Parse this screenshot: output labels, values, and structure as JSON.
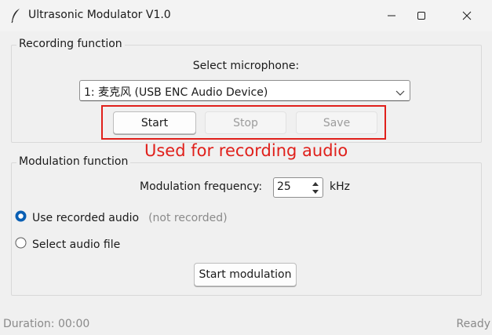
{
  "window": {
    "title": "Ultrasonic Modulator V1.0"
  },
  "recording": {
    "group_label": "Recording function",
    "select_label": "Select microphone:",
    "microphone_value": "1: 麦克风 (USB ENC Audio Device)",
    "start_label": "Start",
    "stop_label": "Stop",
    "save_label": "Save",
    "annotation": "Used for recording audio"
  },
  "modulation": {
    "group_label": "Modulation function",
    "frequency_label": "Modulation frequency:",
    "frequency_value": "25",
    "frequency_unit": "kHz",
    "option_recorded": "Use recorded audio",
    "recorded_status": "(not recorded)",
    "option_file": "Select audio file",
    "selected_option": "Use recorded audio",
    "start_label": "Start modulation"
  },
  "status": {
    "duration": "Duration: 00:00",
    "state": "Ready"
  },
  "colors": {
    "annotation": "#e0201b",
    "radio_selected": "#0a5fb4"
  },
  "icons": {
    "app": "feather-icon",
    "minimize": "minimize-icon",
    "maximize": "maximize-icon",
    "close": "close-icon",
    "dropdown": "chevron-down-icon",
    "spin_up": "arrow-up-icon",
    "spin_down": "arrow-down-icon"
  }
}
